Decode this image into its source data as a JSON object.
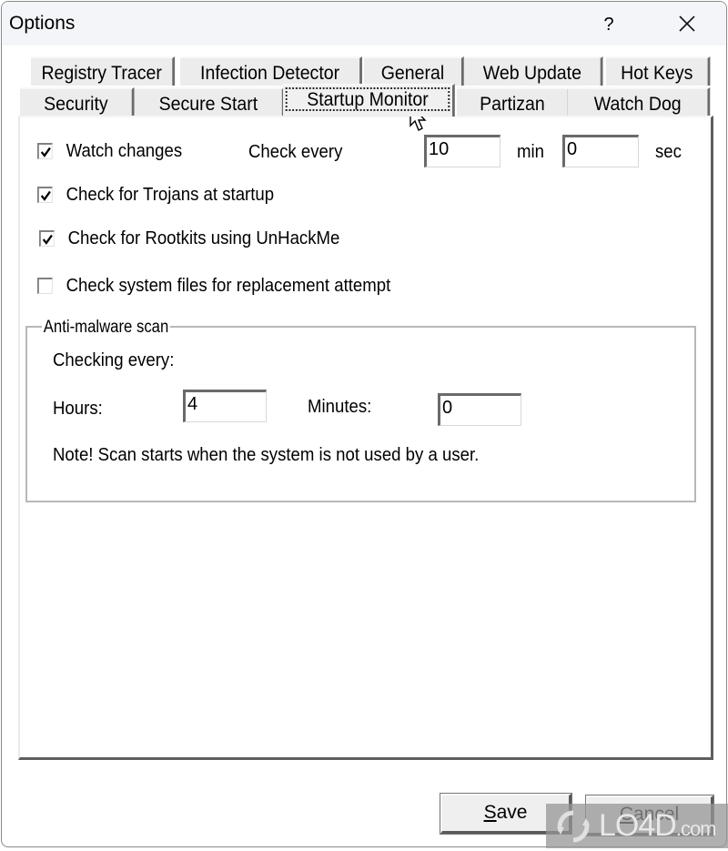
{
  "window": {
    "title": "Options",
    "help_label": "?",
    "close_icon": "close-icon"
  },
  "tabs": {
    "row1": [
      {
        "label": "Registry Tracer"
      },
      {
        "label": "Infection Detector"
      },
      {
        "label": "General"
      },
      {
        "label": "Web Update"
      },
      {
        "label": "Hot Keys"
      }
    ],
    "row2": [
      {
        "label": "Security"
      },
      {
        "label": "Secure Start"
      },
      {
        "label": "Startup Monitor",
        "active": true
      },
      {
        "label": "Partizan"
      },
      {
        "label": "Watch Dog"
      }
    ]
  },
  "startup_monitor": {
    "watch_changes": {
      "label": "Watch changes",
      "checked": true
    },
    "check_every_label": "Check every",
    "check_every_min": "10",
    "min_label": "min",
    "check_every_sec": "0",
    "sec_label": "sec",
    "trojans": {
      "label": "Check for Trojans at startup",
      "checked": true
    },
    "rootkits": {
      "label": "Check for Rootkits using UnHackMe",
      "checked": true
    },
    "system_files": {
      "label": "Check system files for replacement attempt",
      "checked": false
    },
    "antimalware": {
      "title": "Anti-malware scan",
      "checking_every": "Checking every:",
      "hours_label": "Hours:",
      "hours_value": "4",
      "minutes_label": "Minutes:",
      "minutes_value": "0",
      "note": "Note! Scan starts when the system is not used by a user."
    }
  },
  "buttons": {
    "save": {
      "accel": "S",
      "rest": "ave"
    },
    "cancel": {
      "accel": "C",
      "rest": "ancel"
    }
  },
  "watermark": {
    "text": "LO4D",
    "suffix": ".com"
  }
}
